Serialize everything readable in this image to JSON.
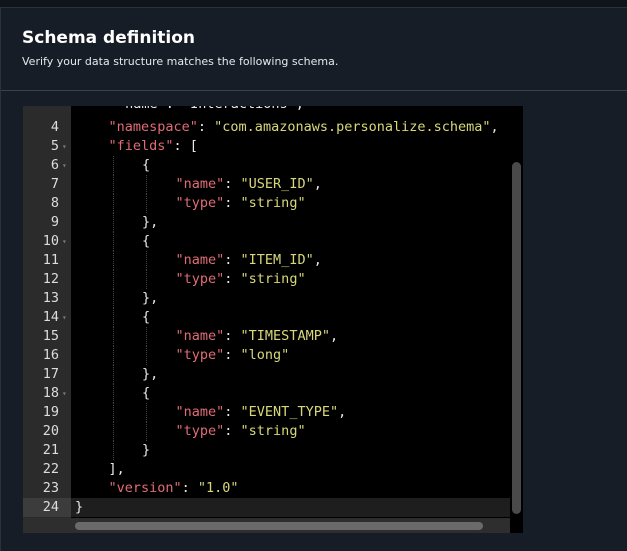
{
  "header": {
    "title": "Schema definition",
    "subtitle": "Verify your data structure matches the following schema."
  },
  "editor": {
    "partial_top_line": "\"name\": \"Interactions\",",
    "lines": [
      {
        "n": "4",
        "fold": false,
        "indent": 1,
        "tokens": [
          [
            "k",
            "\"namespace\""
          ],
          [
            "p",
            ": "
          ],
          [
            "s",
            "\"com.amazonaws.personalize.schema\""
          ],
          [
            "p",
            ","
          ]
        ]
      },
      {
        "n": "5",
        "fold": true,
        "indent": 1,
        "tokens": [
          [
            "k",
            "\"fields\""
          ],
          [
            "p",
            ": ["
          ]
        ]
      },
      {
        "n": "6",
        "fold": true,
        "indent": 2,
        "tokens": [
          [
            "p",
            "{"
          ]
        ]
      },
      {
        "n": "7",
        "fold": false,
        "indent": 3,
        "tokens": [
          [
            "k",
            "\"name\""
          ],
          [
            "p",
            ": "
          ],
          [
            "s",
            "\"USER_ID\""
          ],
          [
            "p",
            ","
          ]
        ]
      },
      {
        "n": "8",
        "fold": false,
        "indent": 3,
        "tokens": [
          [
            "k",
            "\"type\""
          ],
          [
            "p",
            ": "
          ],
          [
            "s",
            "\"string\""
          ]
        ]
      },
      {
        "n": "9",
        "fold": false,
        "indent": 2,
        "tokens": [
          [
            "p",
            "},"
          ]
        ]
      },
      {
        "n": "10",
        "fold": true,
        "indent": 2,
        "tokens": [
          [
            "p",
            "{"
          ]
        ]
      },
      {
        "n": "11",
        "fold": false,
        "indent": 3,
        "tokens": [
          [
            "k",
            "\"name\""
          ],
          [
            "p",
            ": "
          ],
          [
            "s",
            "\"ITEM_ID\""
          ],
          [
            "p",
            ","
          ]
        ]
      },
      {
        "n": "12",
        "fold": false,
        "indent": 3,
        "tokens": [
          [
            "k",
            "\"type\""
          ],
          [
            "p",
            ": "
          ],
          [
            "s",
            "\"string\""
          ]
        ]
      },
      {
        "n": "13",
        "fold": false,
        "indent": 2,
        "tokens": [
          [
            "p",
            "},"
          ]
        ]
      },
      {
        "n": "14",
        "fold": true,
        "indent": 2,
        "tokens": [
          [
            "p",
            "{"
          ]
        ]
      },
      {
        "n": "15",
        "fold": false,
        "indent": 3,
        "tokens": [
          [
            "k",
            "\"name\""
          ],
          [
            "p",
            ": "
          ],
          [
            "s",
            "\"TIMESTAMP\""
          ],
          [
            "p",
            ","
          ]
        ]
      },
      {
        "n": "16",
        "fold": false,
        "indent": 3,
        "tokens": [
          [
            "k",
            "\"type\""
          ],
          [
            "p",
            ": "
          ],
          [
            "s",
            "\"long\""
          ]
        ]
      },
      {
        "n": "17",
        "fold": false,
        "indent": 2,
        "tokens": [
          [
            "p",
            "},"
          ]
        ]
      },
      {
        "n": "18",
        "fold": true,
        "indent": 2,
        "tokens": [
          [
            "p",
            "{"
          ]
        ]
      },
      {
        "n": "19",
        "fold": false,
        "indent": 3,
        "tokens": [
          [
            "k",
            "\"name\""
          ],
          [
            "p",
            ": "
          ],
          [
            "s",
            "\"EVENT_TYPE\""
          ],
          [
            "p",
            ","
          ]
        ]
      },
      {
        "n": "20",
        "fold": false,
        "indent": 3,
        "tokens": [
          [
            "k",
            "\"type\""
          ],
          [
            "p",
            ": "
          ],
          [
            "s",
            "\"string\""
          ]
        ]
      },
      {
        "n": "21",
        "fold": false,
        "indent": 2,
        "tokens": [
          [
            "p",
            "}"
          ]
        ]
      },
      {
        "n": "22",
        "fold": false,
        "indent": 1,
        "tokens": [
          [
            "p",
            "],"
          ]
        ]
      },
      {
        "n": "23",
        "fold": false,
        "indent": 1,
        "tokens": [
          [
            "k",
            "\"version\""
          ],
          [
            "p",
            ": "
          ],
          [
            "s",
            "\"1.0\""
          ]
        ]
      },
      {
        "n": "24",
        "fold": false,
        "indent": 0,
        "active": true,
        "tokens": [
          [
            "p",
            "}"
          ]
        ]
      }
    ]
  },
  "colors": {
    "key": "#e06c75",
    "string": "#d8d87a",
    "punctuation": "#e8e8e8",
    "background": "#000000",
    "panel": "#161d26"
  }
}
